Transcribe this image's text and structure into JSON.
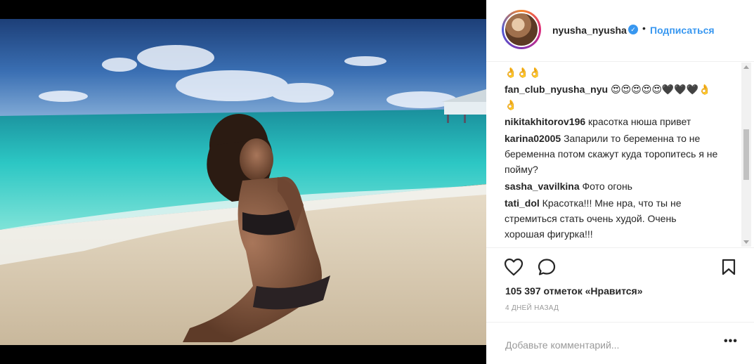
{
  "post": {
    "username": "nyusha_nyusha",
    "verified_mark": "✓",
    "separator": "•",
    "follow_label": "Подписаться",
    "photo_alt": "Instagram photo"
  },
  "comments": [
    {
      "user": "",
      "text": "👌👌👌"
    },
    {
      "user": "fan_club_nyusha_nyu",
      "text": "😍😍😍😍😍🖤🖤🖤👌👌"
    },
    {
      "user": "nikitakhitorov196",
      "text": "красотка нюша привет"
    },
    {
      "user": "karina02005",
      "text": "Запарили то беременна то не беременна потом скажут куда торопитесь я не пойму?"
    },
    {
      "user": "sasha_vavilkina",
      "text": "Фото огонь"
    },
    {
      "user": "tati_dol",
      "text": "Красотка!!! Мне нра, что ты не стремиться стать очень худой. Очень хорошая фигурка!!!"
    }
  ],
  "actions": {
    "like_icon": "heart-icon",
    "comment_icon": "speech-bubble-icon",
    "save_icon": "bookmark-icon",
    "likes_text": "105 397 отметок «Нравится»",
    "time_ago": "4 ДНЕЙ НАЗАД"
  },
  "comment_box": {
    "placeholder": "Добавьте комментарий...",
    "more_label": "•••"
  },
  "colors": {
    "accent": "#3897f0",
    "text": "#262626",
    "muted": "#999999",
    "divider": "#efefef"
  }
}
